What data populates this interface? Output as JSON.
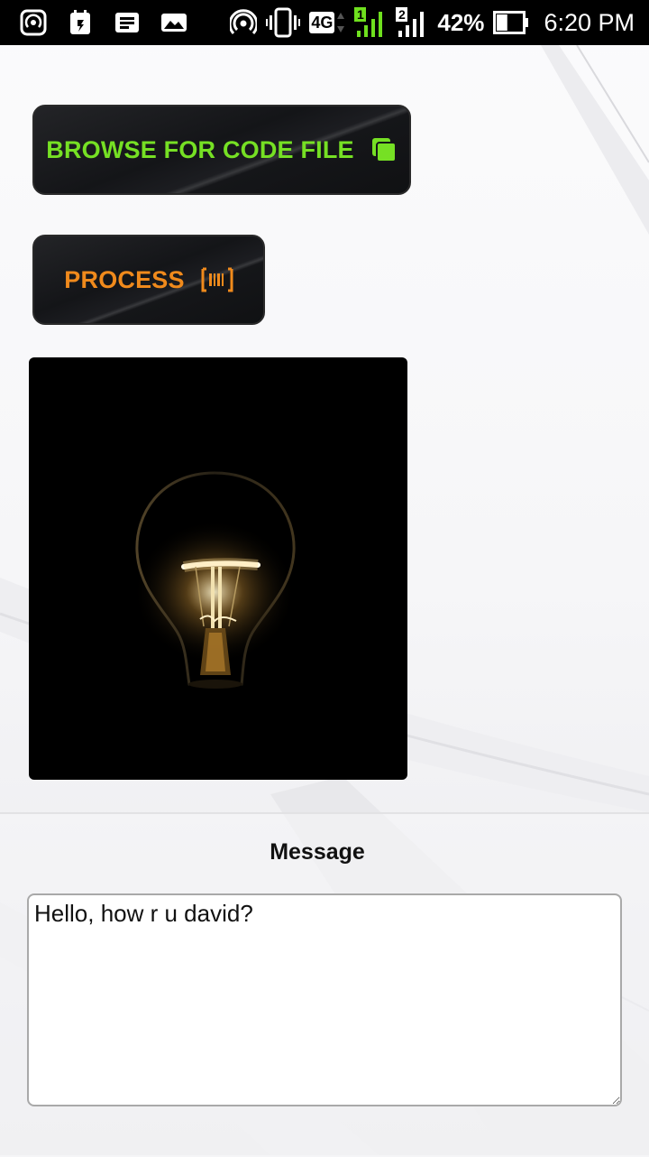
{
  "status_bar": {
    "left_icons": [
      "hotspot-icon",
      "calendar-app-icon",
      "notes-app-icon",
      "gallery-icon"
    ],
    "right_icons": [
      "wifi-tether-icon",
      "vibrate-icon",
      "network-4g-icon",
      "sim1-signal-icon",
      "sim2-signal-icon",
      "battery-icon"
    ],
    "network_type": "4G",
    "sim1_label": "1",
    "sim2_label": "2",
    "battery_percent": "42%",
    "battery_level": 0.42,
    "time": "6:20 PM"
  },
  "buttons": {
    "browse_label": "BROWSE FOR CODE FILE",
    "browse_icon": "copy-icon",
    "browse_color": "#76e024",
    "process_label": "PROCESS",
    "process_icon": "barcode-icon",
    "process_color": "#f08a1c"
  },
  "image": {
    "subject": "lightbulb-image"
  },
  "message": {
    "title": "Message",
    "value": "Hello, how r u david?"
  }
}
